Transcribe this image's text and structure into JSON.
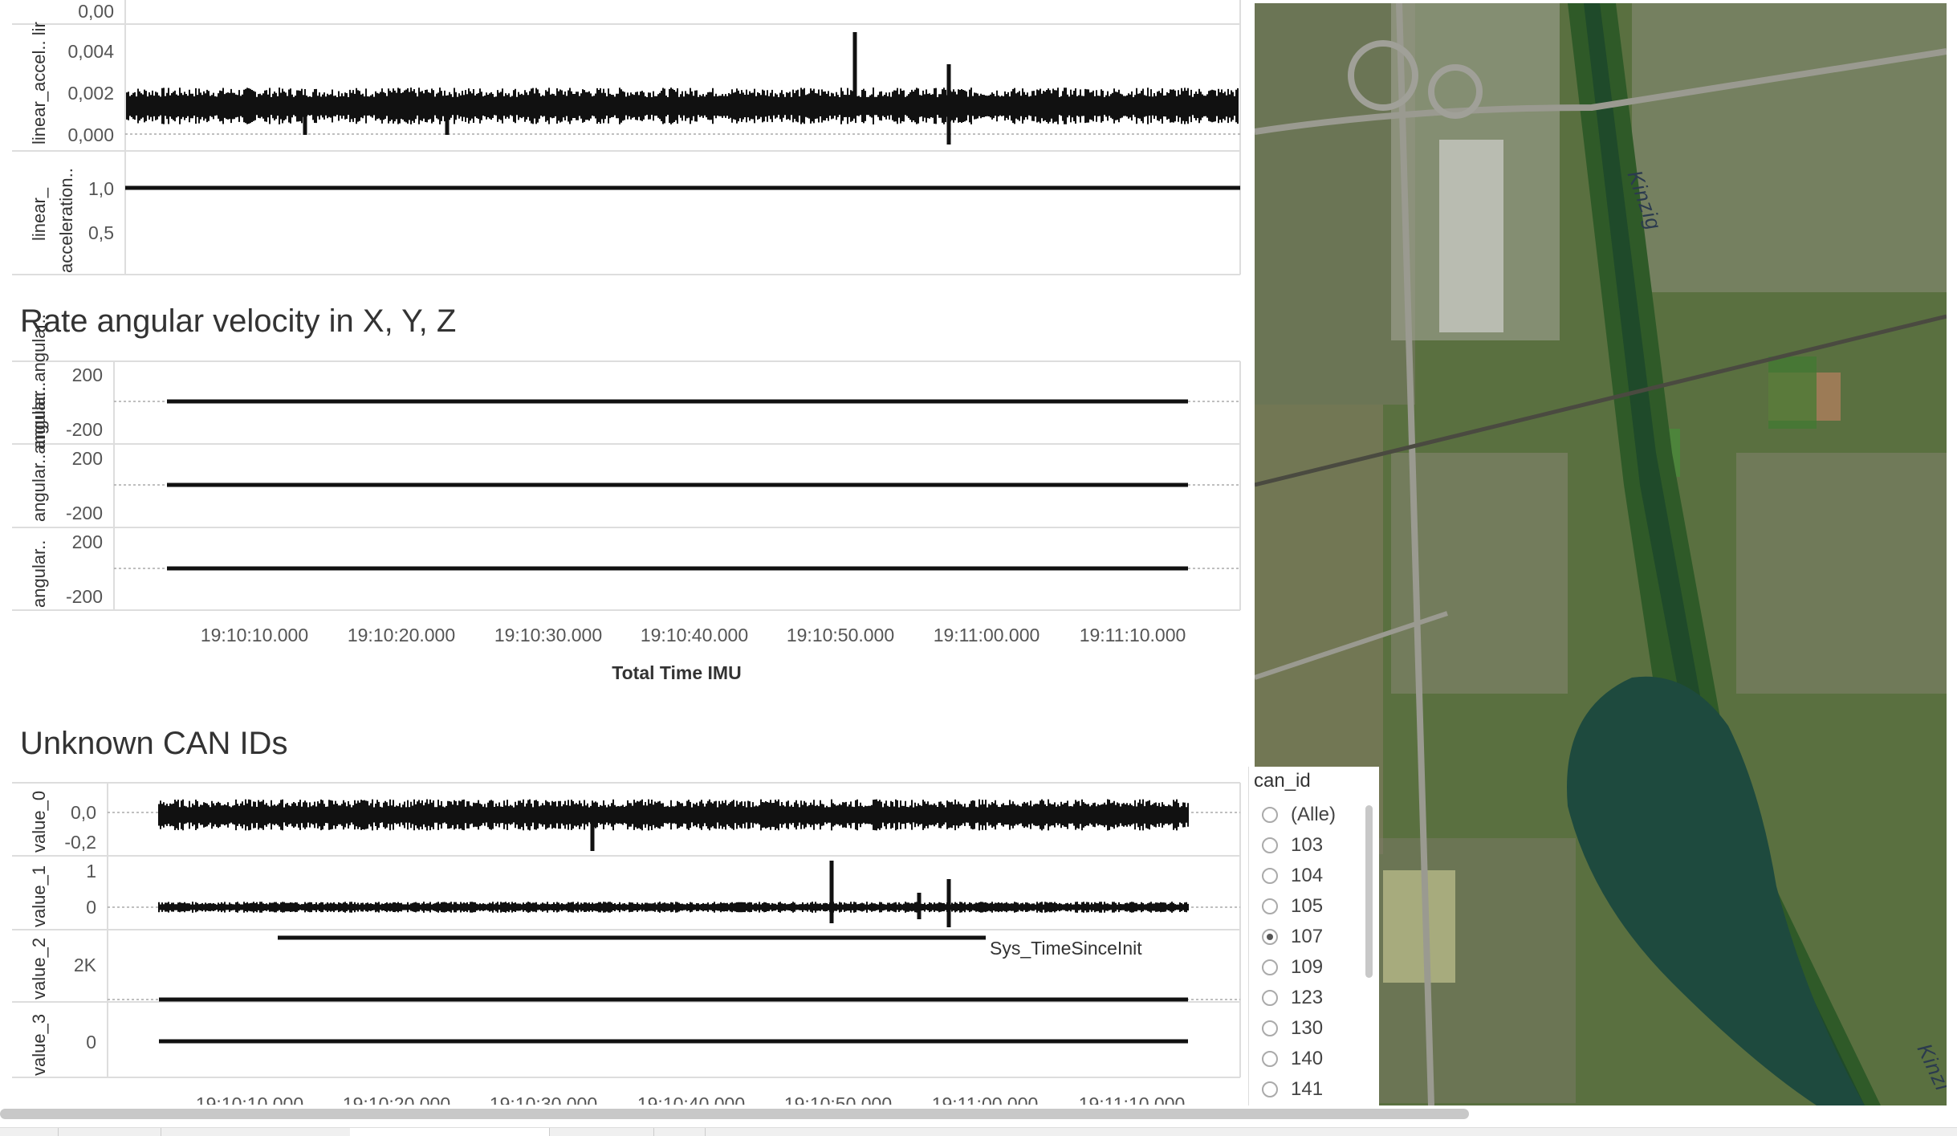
{
  "accel_panel": {
    "y_ticks_top": [
      "0,00",
      "0,004",
      "0,002",
      "0,000"
    ],
    "y_ticks_bottom": [
      "1,0",
      "0,5"
    ],
    "axis_label_top": "linear_accel.. lir",
    "axis_label_bottom_1": "linear_",
    "axis_label_bottom_2": "acceleration.."
  },
  "angular_panel": {
    "title": "Rate angular velocity in X, Y, Z",
    "rows": [
      {
        "axis_label": "angular..angular..",
        "tick_top": "200",
        "tick_bottom": "-200"
      },
      {
        "axis_label": "angular..angular..",
        "tick_top": "200",
        "tick_bottom": "-200"
      },
      {
        "axis_label": "angular..",
        "tick_top": "200",
        "tick_bottom": "-200"
      }
    ],
    "x_ticks": [
      "19:10:10.000",
      "19:10:20.000",
      "19:10:30.000",
      "19:10:40.000",
      "19:10:50.000",
      "19:11:00.000",
      "19:11:10.000"
    ],
    "x_title": "Total Time IMU"
  },
  "can_panel": {
    "title": "Unknown CAN IDs",
    "rows": [
      {
        "axis_label": "value_0",
        "ticks": [
          "0,0",
          "-0,2"
        ]
      },
      {
        "axis_label": "value_1",
        "ticks": [
          "1",
          "0"
        ]
      },
      {
        "axis_label": "value_2",
        "ticks": [
          "2K"
        ]
      },
      {
        "axis_label": "value_3",
        "ticks": [
          "0"
        ]
      }
    ],
    "annotation": "Sys_TimeSinceInit",
    "x_ticks": [
      "19:10:10.000",
      "19:10:20.000",
      "19:10:30.000",
      "19:10:40.000",
      "19:10:50.000",
      "19:11:00.000",
      "19:11:10.000"
    ]
  },
  "map": {
    "river_label_1": "Kinzig",
    "river_label_2": "Kinzi"
  },
  "filter": {
    "title": "can_id",
    "options": [
      "(Alle)",
      "103",
      "104",
      "105",
      "107",
      "109",
      "123",
      "130",
      "140",
      "141"
    ],
    "selected": "107"
  },
  "chart_data": [
    {
      "type": "line",
      "title": "",
      "series": [
        {
          "values": [
            0.0015,
            0.0016,
            0.0015,
            0.0017,
            0.0016,
            0.0015,
            0.0016,
            0.0015,
            0.0016,
            0.0015,
            0.0016
          ]
        },
        {
          "values": [
            1.0,
            1.0,
            1.0,
            1.0,
            1.0,
            1.0,
            1.0,
            1.0,
            1.0,
            1.0,
            1.0
          ]
        }
      ],
      "ylim_top": [
        0,
        0.005
      ],
      "ylim_bottom": [
        0.3,
        1.1
      ]
    },
    {
      "type": "line",
      "title": "Rate angular velocity in X, Y, Z",
      "xlabel": "Total Time IMU",
      "series": [
        {
          "values": [
            0,
            0,
            0,
            0,
            0,
            0,
            0
          ]
        },
        {
          "values": [
            0,
            0,
            0,
            0,
            0,
            0,
            0
          ]
        },
        {
          "values": [
            0,
            0,
            0,
            0,
            0,
            0,
            0
          ]
        }
      ],
      "ylim": [
        -200,
        200
      ]
    },
    {
      "type": "line",
      "title": "Unknown CAN IDs",
      "series": [
        {
          "name": "value_0",
          "values": [
            0,
            0,
            0,
            0,
            0,
            0,
            0
          ]
        },
        {
          "name": "value_1",
          "values": [
            0,
            0,
            0,
            0,
            0,
            0,
            0
          ]
        },
        {
          "name": "value_2",
          "values": [
            2000,
            2000,
            2000,
            2000,
            2000,
            2000,
            2000
          ]
        },
        {
          "name": "value_3",
          "values": [
            0,
            0,
            0,
            0,
            0,
            0,
            0
          ]
        }
      ]
    }
  ]
}
